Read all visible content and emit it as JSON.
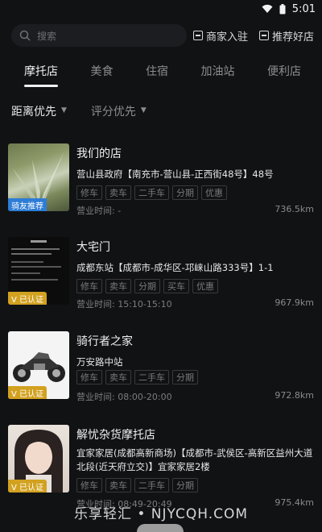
{
  "status": {
    "time": "5:01"
  },
  "header": {
    "search_placeholder": "搜索",
    "merchant_btn": "商家入驻",
    "recommend_btn": "推荐好店"
  },
  "tabs": [
    {
      "label": "摩托店",
      "active": true
    },
    {
      "label": "美食"
    },
    {
      "label": "住宿"
    },
    {
      "label": "加油站"
    },
    {
      "label": "便利店"
    }
  ],
  "sort": [
    {
      "label": "距离优先",
      "active": true
    },
    {
      "label": "评分优先"
    }
  ],
  "shops": [
    {
      "name": "我们的店",
      "address": "营山县政府【南充市-营山县-正西街48号】48号",
      "tags": [
        "修车",
        "卖车",
        "二手车",
        "分期",
        "优惠"
      ],
      "hours": "营业时间: -",
      "distance": "736.5km",
      "badge": "骑友推荐"
    },
    {
      "name": "大宅门",
      "address": "成都东站【成都市-成华区-邛崃山路333号】1-1",
      "tags": [
        "修车",
        "卖车",
        "分期",
        "买车",
        "优惠"
      ],
      "hours": "营业时间: 15:10-15:10",
      "distance": "967.9km",
      "badge": "V 已认证"
    },
    {
      "name": "骑行者之家",
      "address": "万安路中站",
      "tags": [
        "修车",
        "卖车",
        "二手车",
        "分期"
      ],
      "hours": "营业时间: 08:00-20:00",
      "distance": "972.8km",
      "badge": "V 已认证"
    },
    {
      "name": "解忧杂货摩托店",
      "address": "宜家家居(成都高新商场)【成都市-武侯区-高新区益州大道北段(近天府立交)】宜家家居2楼",
      "tags": [
        "修车",
        "卖车",
        "二手车",
        "分期"
      ],
      "hours": "营业时间: 08:49-20:49",
      "distance": "975.4km",
      "badge": "V 已认证"
    }
  ],
  "watermark": "乐享轻汇 • NJYCQH.COM"
}
